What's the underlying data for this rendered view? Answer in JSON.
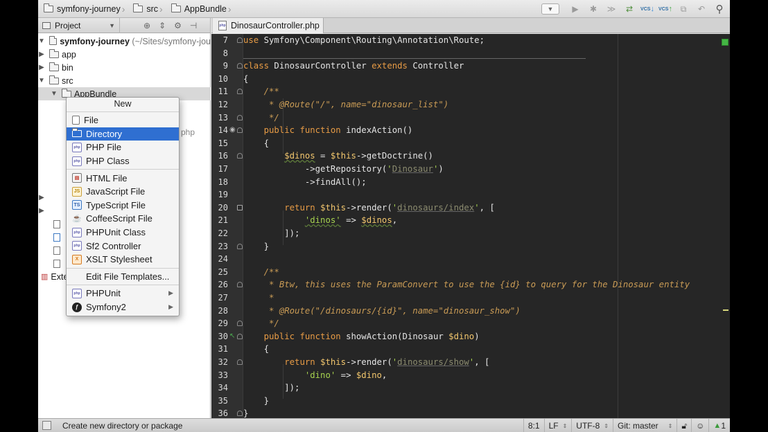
{
  "breadcrumbs": [
    "symfony-journey",
    "src",
    "AppBundle"
  ],
  "project_panel": {
    "view_mode": "Project",
    "tree": {
      "root_name": "symfony-journey",
      "root_path": "(~/Sites/symfony-jou",
      "items": [
        "app",
        "bin",
        "src",
        "AppBundle"
      ],
      "external_label": "Exte",
      "partial_text": "php"
    }
  },
  "context_menu": {
    "title": "New",
    "items": [
      {
        "label": "File",
        "icon": "file-icon"
      },
      {
        "label": "Directory",
        "icon": "folder-icon",
        "highlighted": true
      },
      {
        "label": "PHP File",
        "icon": "php-file-icon"
      },
      {
        "label": "PHP Class",
        "icon": "php-class-icon"
      },
      {
        "label": "HTML File",
        "icon": "html-file-icon"
      },
      {
        "label": "JavaScript File",
        "icon": "javascript-file-icon"
      },
      {
        "label": "TypeScript File",
        "icon": "typescript-file-icon"
      },
      {
        "label": "CoffeeScript File",
        "icon": "coffeescript-file-icon"
      },
      {
        "label": "PHPUnit Class",
        "icon": "phpunit-class-icon"
      },
      {
        "label": "Sf2 Controller",
        "icon": "sf2-controller-icon"
      },
      {
        "label": "XSLT Stylesheet",
        "icon": "xslt-stylesheet-icon"
      },
      {
        "label": "Edit File Templates...",
        "icon": ""
      },
      {
        "label": "PHPUnit",
        "icon": "phpunit-icon",
        "submenu": true
      },
      {
        "label": "Symfony2",
        "icon": "symfony-icon",
        "submenu": true
      }
    ]
  },
  "editor": {
    "tab_label": "DinosaurController.php",
    "line_numbers": [
      "7",
      "8",
      "9",
      "10",
      "11",
      "12",
      "13",
      "14",
      "15",
      "16",
      "17",
      "18",
      "19",
      "20",
      "21",
      "22",
      "23",
      "24",
      "25",
      "26",
      "27",
      "28",
      "29",
      "30",
      "31",
      "32",
      "33",
      "34",
      "35",
      "36"
    ],
    "colors": {
      "keyword": "#e79b45",
      "variable": "#f2c66d",
      "string": "#a6d24f",
      "comment": "#c99b55",
      "background": "#262626"
    }
  },
  "status_bar": {
    "message": "Create new directory or package",
    "position": "8:1",
    "line_separator": "LF",
    "encoding": "UTF-8",
    "vcs_branch": "Git: master",
    "notifications": "1"
  },
  "toolbar": {
    "vcs_label": "VCS"
  }
}
